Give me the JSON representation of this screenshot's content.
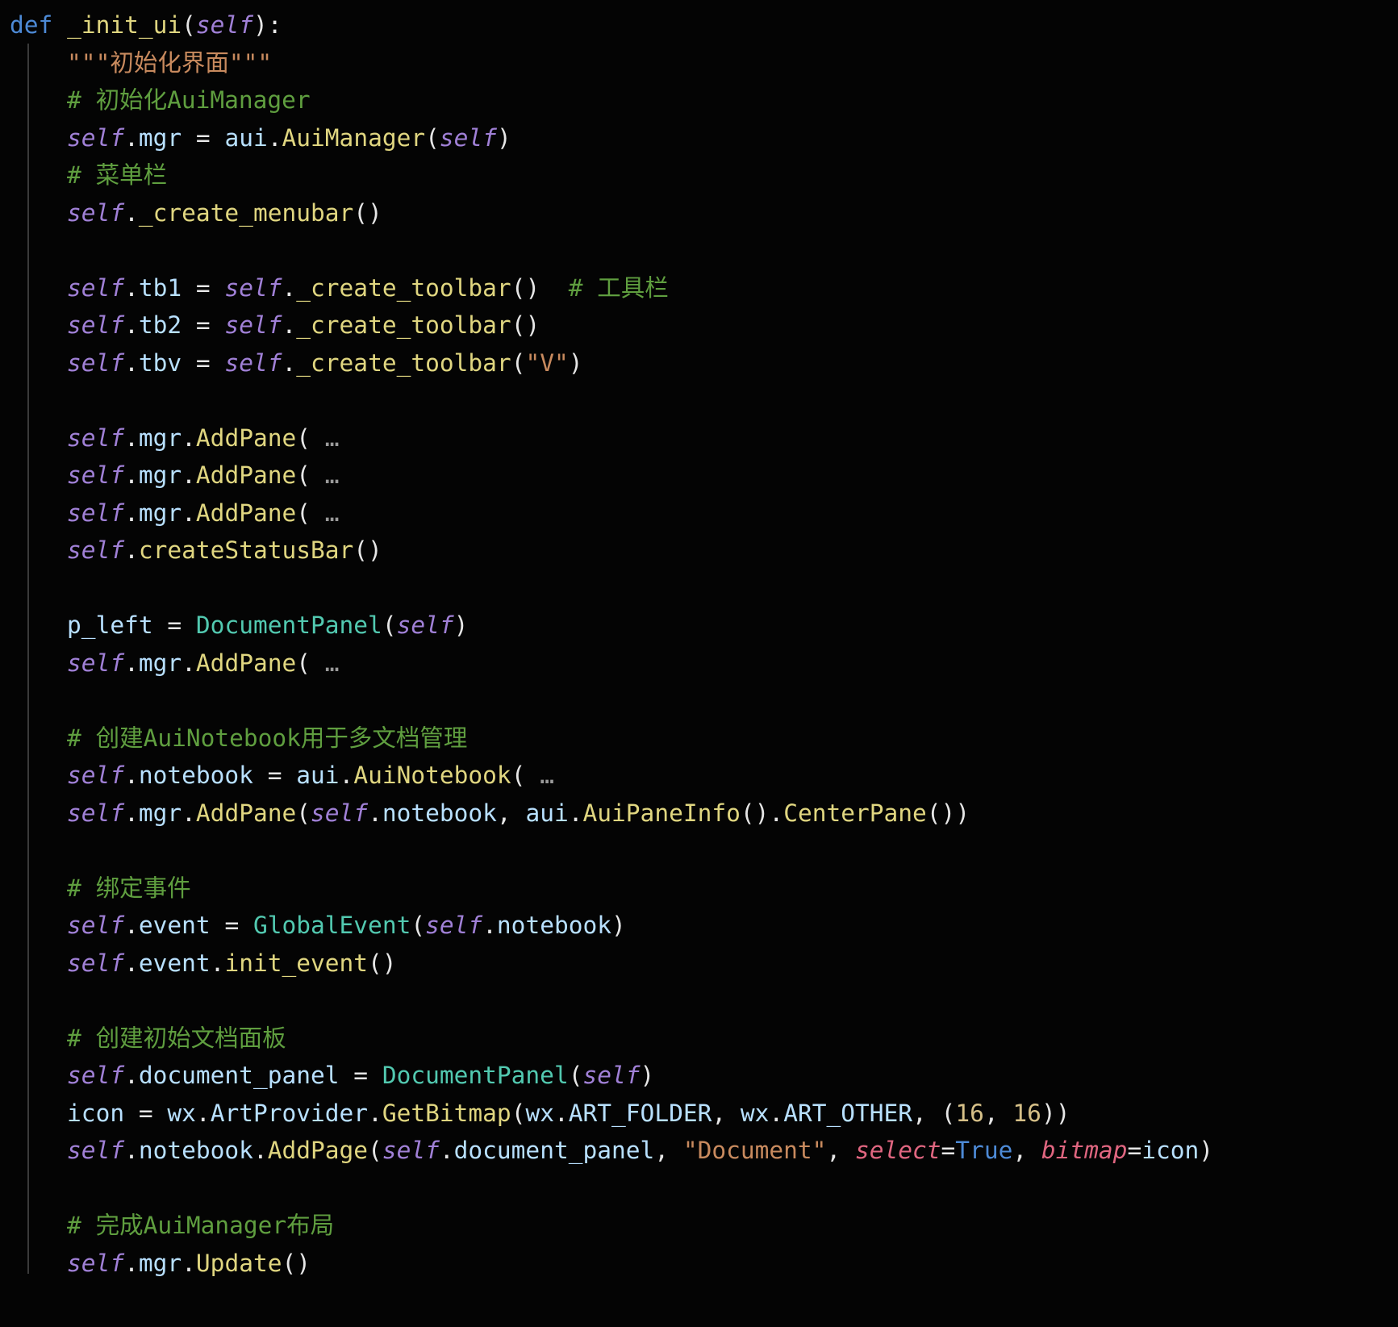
{
  "code": {
    "def": "def",
    "fn_name": "_init_ui",
    "self": "self",
    "docstring": "\"\"\"初始化界面\"\"\"",
    "cmt_init_mgr": "# 初始化AuiManager",
    "mgr": "mgr",
    "aui": "aui",
    "AuiManager": "AuiManager",
    "cmt_menubar": "# 菜单栏",
    "create_menubar": "_create_menubar",
    "tb1": "tb1",
    "tb2": "tb2",
    "tbv": "tbv",
    "create_toolbar": "_create_toolbar",
    "cmt_toolbar": "# 工具栏",
    "VLit": "\"V\"",
    "AddPane": "AddPane",
    "fold": "…",
    "createStatusBar": "createStatusBar",
    "p_left": "p_left",
    "DocumentPanel": "DocumentPanel",
    "cmt_notebook": "# 创建AuiNotebook用于多文档管理",
    "notebook": "notebook",
    "AuiNotebook": "AuiNotebook",
    "AuiPaneInfo": "AuiPaneInfo",
    "CenterPane": "CenterPane",
    "cmt_bind": "# 绑定事件",
    "event": "event",
    "GlobalEvent": "GlobalEvent",
    "init_event": "init_event",
    "cmt_docpanel": "# 创建初始文档面板",
    "document_panel": "document_panel",
    "icon": "icon",
    "wx": "wx",
    "ArtProvider": "ArtProvider",
    "GetBitmap": "GetBitmap",
    "ART_FOLDER": "ART_FOLDER",
    "ART_OTHER": "ART_OTHER",
    "sixteen": "16",
    "AddPage": "AddPage",
    "DocumentLit": "\"Document\"",
    "select": "select",
    "True": "True",
    "bitmap": "bitmap",
    "cmt_finish": "# 完成AuiManager布局",
    "Update": "Update"
  }
}
